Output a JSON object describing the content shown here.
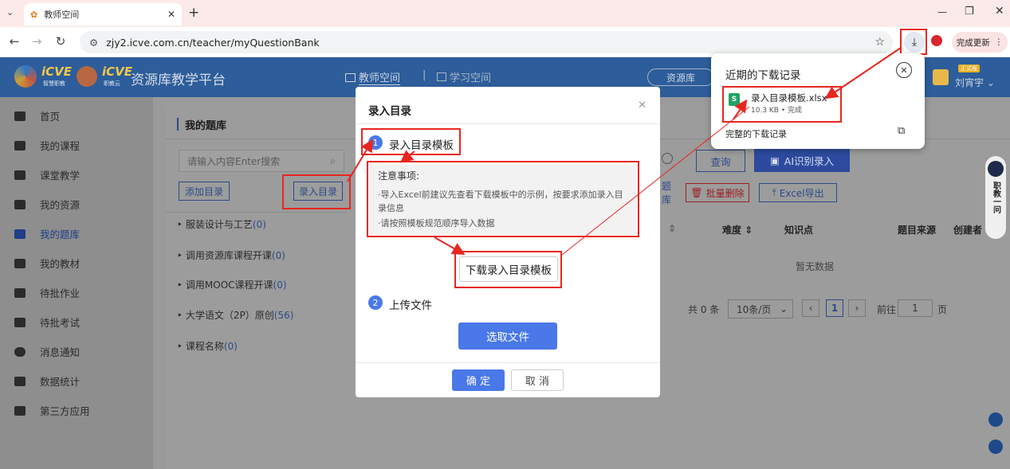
{
  "browser": {
    "tab_title": "教师空间",
    "url": "zjy2.icve.com.cn/teacher/myQuestionBank",
    "update_label": "完成更新"
  },
  "header": {
    "brand1": "iCVE",
    "brand1_sub": "智慧职教",
    "brand2": "iCVE",
    "brand2_sub": "职教云",
    "platform": "资源库教学平台",
    "nav_teacher": "教师空间",
    "nav_learn": "学习空间",
    "nav_resource": "资源库",
    "user_badge": "正式版",
    "user_name": "刘宵宇"
  },
  "sidebar": {
    "items": [
      {
        "label": "首页"
      },
      {
        "label": "我的课程"
      },
      {
        "label": "课堂教学"
      },
      {
        "label": "我的资源"
      },
      {
        "label": "我的题库"
      },
      {
        "label": "我的教材"
      },
      {
        "label": "待批作业"
      },
      {
        "label": "待批考试"
      },
      {
        "label": "消息通知"
      },
      {
        "label": "数据统计"
      },
      {
        "label": "第三方应用"
      }
    ]
  },
  "main": {
    "title": "我的题库",
    "search_placeholder": "请输入内容Enter搜索",
    "add_catalog": "添加目录",
    "import_catalog": "录入目录",
    "tree": [
      {
        "label": "服装设计与工艺",
        "count": "(0)"
      },
      {
        "label": "调用资源库课程开课",
        "count": "(0)"
      },
      {
        "label": "调用MOOC课程开课",
        "count": "(0)"
      },
      {
        "label": "大学语文（2P）原创",
        "count": "(56)"
      },
      {
        "label": "课程名称",
        "count": "(0)"
      }
    ],
    "query": "查询",
    "ai_import": "AI识别录入",
    "suffix_bank": "题库",
    "batch_delete": "批量删除",
    "excel_export": "Excel导出",
    "columns": [
      "难度",
      "知识点",
      "题目来源",
      "创建者"
    ],
    "empty": "暂无数据",
    "total": "共 0 条",
    "page_size": "10条/页",
    "page": "1",
    "goto_label": "前往",
    "goto_value": "1",
    "page_unit": "页"
  },
  "modal": {
    "title": "录入目录",
    "step1_num": "1",
    "step1": "录入目录模板",
    "notice_title": "注意事项:",
    "notice1": "·导入Excel前建议先查看下载模板中的示例，按要求添加录入目录信息",
    "notice2": "·请按照模板规范顺序导入数据",
    "download_btn": "下载录入目录模板",
    "step2_num": "2",
    "step2": "上传文件",
    "choose_file": "选取文件",
    "confirm": "确 定",
    "cancel": "取 消"
  },
  "downloads": {
    "title": "近期的下载记录",
    "file_name": "录入目录模板.xlsx",
    "file_meta": "10.3 KB • 完成",
    "full_history": "完整的下载记录"
  },
  "float_widget": {
    "label": "职教一问"
  },
  "colors": {
    "brand_blue": "#2d5d9a",
    "primary": "#4a78e8",
    "annotation_red": "#e8261f"
  }
}
